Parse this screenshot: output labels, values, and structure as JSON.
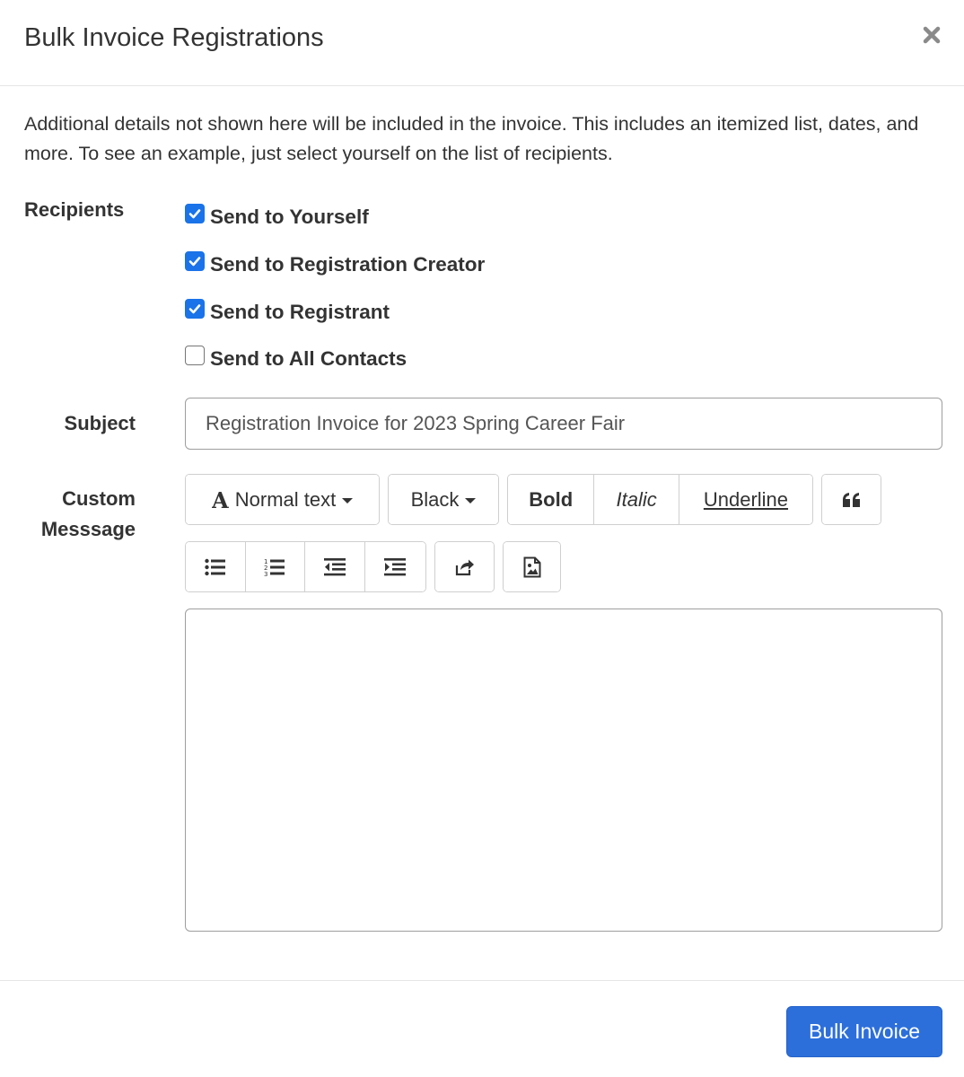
{
  "modal": {
    "title": "Bulk Invoice Registrations",
    "close_icon": "close-icon"
  },
  "intro_text": "Additional details not shown here will be included in the invoice. This includes an itemized list, dates, and more. To see an example, just select yourself on the list of recipients.",
  "recipients": {
    "label": "Recipients",
    "options": [
      {
        "label": "Send to Yourself",
        "checked": true
      },
      {
        "label": "Send to Registration Creator",
        "checked": true
      },
      {
        "label": "Send to Registrant",
        "checked": true
      },
      {
        "label": "Send to All Contacts",
        "checked": false
      }
    ]
  },
  "subject": {
    "label": "Subject",
    "value": "Registration Invoice for 2023 Spring Career Fair"
  },
  "custom_message": {
    "label_line1": "Custom",
    "label_line2": "Messsage",
    "toolbar": {
      "heading_select": "Normal text",
      "color_select": "Black",
      "bold": "Bold",
      "italic": "Italic",
      "underline": "Underline",
      "icons": [
        "font-icon",
        "caret-down-icon",
        "quote-icon",
        "bullet-list-icon",
        "numbered-list-icon",
        "outdent-icon",
        "indent-icon",
        "share-link-icon",
        "image-icon"
      ]
    },
    "value": ""
  },
  "footer": {
    "submit_label": "Bulk Invoice"
  },
  "colors": {
    "primary": "#2c6fdb",
    "checkbox_checked": "#1a73e8",
    "text": "#333333",
    "border": "#cfcfcf"
  }
}
